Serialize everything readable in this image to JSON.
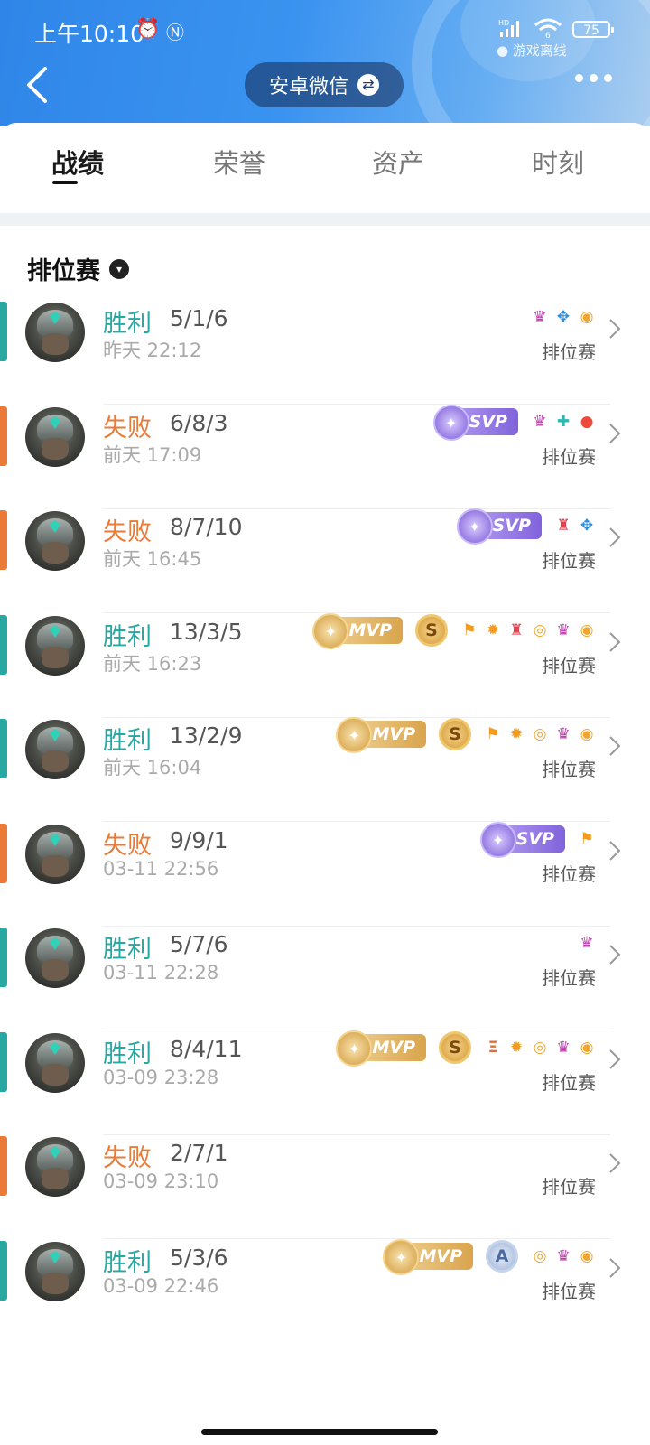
{
  "status_bar": {
    "time": "上午10:10",
    "network": "HD",
    "wifi_label": "6",
    "battery": "75",
    "game_status": "● 游戏离线"
  },
  "header": {
    "platform_label": "安卓微信",
    "swap_glyph": "⇄"
  },
  "tabs": [
    {
      "label": "战绩",
      "active": true
    },
    {
      "label": "荣誉",
      "active": false
    },
    {
      "label": "资产",
      "active": false
    },
    {
      "label": "时刻",
      "active": false
    }
  ],
  "section": {
    "title": "排位赛",
    "dropdown_glyph": "▾"
  },
  "colors": {
    "win": "#27a8a2",
    "loss": "#ea7a36",
    "header_blue": "#3b93f0"
  },
  "matches": [
    {
      "result": "胜利",
      "outcome": "win",
      "kda": "5/1/6",
      "time": "昨天 22:12",
      "mode": "排位赛",
      "badges": [],
      "icons": [
        "demon-icon",
        "wings-icon",
        "coins-icon"
      ]
    },
    {
      "result": "失败",
      "outcome": "loss",
      "kda": "6/8/3",
      "time": "前天 17:09",
      "mode": "排位赛",
      "badges": [
        {
          "type": "svp",
          "label": "SVP"
        }
      ],
      "icons": [
        "demon-icon",
        "heal-icon",
        "blood-icon"
      ]
    },
    {
      "result": "失败",
      "outcome": "loss",
      "kda": "8/7/10",
      "time": "前天 16:45",
      "mode": "排位赛",
      "badges": [
        {
          "type": "svp",
          "label": "SVP"
        }
      ],
      "icons": [
        "tower-icon",
        "wings-icon"
      ]
    },
    {
      "result": "胜利",
      "outcome": "win",
      "kda": "13/3/5",
      "time": "前天 16:23",
      "mode": "排位赛",
      "badges": [
        {
          "type": "mvp",
          "label": "MVP"
        },
        {
          "type": "s",
          "label": "S"
        }
      ],
      "icons": [
        "flag-icon",
        "fire-icon",
        "tower-icon",
        "gold-icon",
        "demon-icon",
        "coins-icon"
      ]
    },
    {
      "result": "胜利",
      "outcome": "win",
      "kda": "13/2/9",
      "time": "前天 16:04",
      "mode": "排位赛",
      "badges": [
        {
          "type": "mvp",
          "label": "MVP"
        },
        {
          "type": "s",
          "label": "S"
        }
      ],
      "icons": [
        "flag-icon",
        "fire-icon",
        "gold-icon",
        "demon-icon",
        "coins-icon"
      ]
    },
    {
      "result": "失败",
      "outcome": "loss",
      "kda": "9/9/1",
      "time": "03-11 22:56",
      "mode": "排位赛",
      "badges": [
        {
          "type": "svp",
          "label": "SVP"
        }
      ],
      "icons": [
        "flag-icon"
      ]
    },
    {
      "result": "胜利",
      "outcome": "win",
      "kda": "5/7/6",
      "time": "03-11 22:28",
      "mode": "排位赛",
      "badges": [],
      "icons": [
        "demon-icon"
      ]
    },
    {
      "result": "胜利",
      "outcome": "win",
      "kda": "8/4/11",
      "time": "03-09 23:28",
      "mode": "排位赛",
      "badges": [
        {
          "type": "mvp",
          "label": "MVP"
        },
        {
          "type": "s",
          "label": "S"
        }
      ],
      "icons": [
        "triple-kill-icon",
        "fire-icon",
        "gold-icon",
        "demon-icon",
        "coins-icon"
      ]
    },
    {
      "result": "失败",
      "outcome": "loss",
      "kda": "2/7/1",
      "time": "03-09 23:10",
      "mode": "排位赛",
      "badges": [],
      "icons": []
    },
    {
      "result": "胜利",
      "outcome": "win",
      "kda": "5/3/6",
      "time": "03-09 22:46",
      "mode": "排位赛",
      "badges": [
        {
          "type": "mvp",
          "label": "MVP"
        },
        {
          "type": "a",
          "label": "A"
        }
      ],
      "icons": [
        "gold-icon",
        "demon-icon",
        "coins-icon"
      ]
    }
  ]
}
